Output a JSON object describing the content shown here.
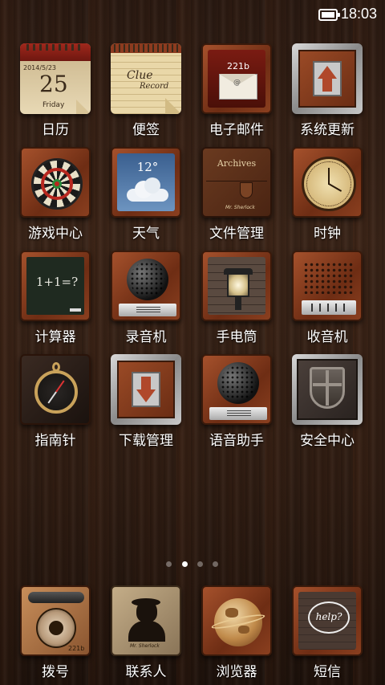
{
  "status_bar": {
    "battery_level": 1.0,
    "time": "18:03"
  },
  "apps": [
    {
      "id": "calendar",
      "label": "日历",
      "icon": "calendar-icon",
      "date": "2014/5/23",
      "day": "25",
      "weekday": "Friday"
    },
    {
      "id": "notes",
      "label": "便签",
      "icon": "notepad-icon",
      "text1": "Clue",
      "text2": "Record"
    },
    {
      "id": "email",
      "label": "电子邮件",
      "icon": "mailbox-icon",
      "number": "221b"
    },
    {
      "id": "update",
      "label": "系统更新",
      "icon": "up-arrow-icon"
    },
    {
      "id": "games",
      "label": "游戏中心",
      "icon": "dartboard-icon"
    },
    {
      "id": "weather",
      "label": "天气",
      "icon": "cloud-icon",
      "temp": "12°"
    },
    {
      "id": "files",
      "label": "文件管理",
      "icon": "wallet-icon",
      "title": "Archives",
      "sub": "Mr. Sherlock"
    },
    {
      "id": "clock",
      "label": "时钟",
      "icon": "clock-icon"
    },
    {
      "id": "calculator",
      "label": "计算器",
      "icon": "chalkboard-icon",
      "formula": "1+1=?"
    },
    {
      "id": "recorder",
      "label": "录音机",
      "icon": "microphone-icon"
    },
    {
      "id": "flashlight",
      "label": "手电筒",
      "icon": "lantern-icon"
    },
    {
      "id": "radio",
      "label": "收音机",
      "icon": "radio-icon"
    },
    {
      "id": "compass",
      "label": "指南针",
      "icon": "compass-icon"
    },
    {
      "id": "download",
      "label": "下载管理",
      "icon": "down-arrow-icon"
    },
    {
      "id": "voice",
      "label": "语音助手",
      "icon": "speaker-icon"
    },
    {
      "id": "security",
      "label": "安全中心",
      "icon": "shield-icon"
    }
  ],
  "dock": [
    {
      "id": "phone",
      "label": "拨号",
      "icon": "rotary-phone-icon",
      "number": "221b"
    },
    {
      "id": "contacts",
      "label": "联系人",
      "icon": "silhouette-icon",
      "sub": "Mr. Sherlock"
    },
    {
      "id": "browser",
      "label": "浏览器",
      "icon": "globe-icon"
    },
    {
      "id": "messages",
      "label": "短信",
      "icon": "speech-bubble-icon",
      "text": "help?"
    }
  ],
  "page_indicator": {
    "count": 4,
    "active": 1
  }
}
